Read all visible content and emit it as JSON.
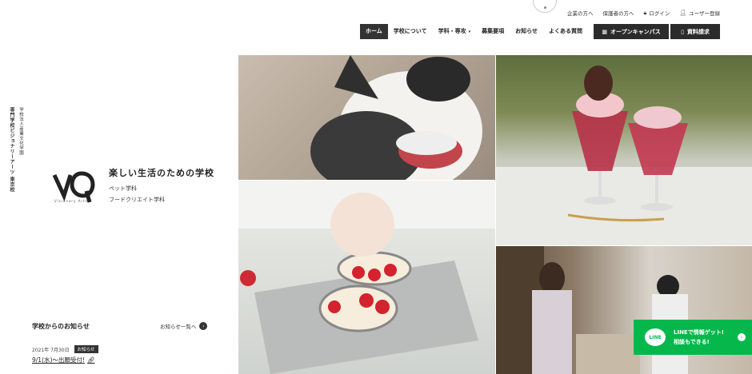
{
  "utility_links": [
    {
      "label": "企業の方へ",
      "icon": ""
    },
    {
      "label": "保護者の方へ",
      "icon": ""
    },
    {
      "label": "ログイン",
      "icon": "lock-icon"
    },
    {
      "label": "ユーザー登録",
      "icon": "user-icon"
    }
  ],
  "nav": {
    "items": [
      "ホーム",
      "学校について",
      "学科・専攻",
      "募集要項",
      "お知らせ",
      "よくある質問"
    ],
    "open_campus": "オープンキャンパス",
    "brochure": "資料請求"
  },
  "school": {
    "vertical_name": "専門学校ビジョナリーアーツ 東京校",
    "vertical_corp": "学校法人産業文化学園",
    "logo_sub": "Visionary Arts",
    "tagline": "楽しい生活のための学校",
    "departments": [
      "ペット学科",
      "フードクリエイト学科"
    ]
  },
  "news": {
    "title": "学校からのお知らせ",
    "view_all": "お知らせ一覧へ",
    "date": "2021年 7月30日",
    "badge": "お知らせ",
    "item": "9/1(水)〜出願受付!"
  },
  "line_banner": {
    "line1": "LINEで情報ゲット!",
    "line2": "相談もできる!",
    "logo_text": "LINE"
  },
  "colors": {
    "accent_dark": "#2b2b2b",
    "line_green": "#06b84c"
  }
}
